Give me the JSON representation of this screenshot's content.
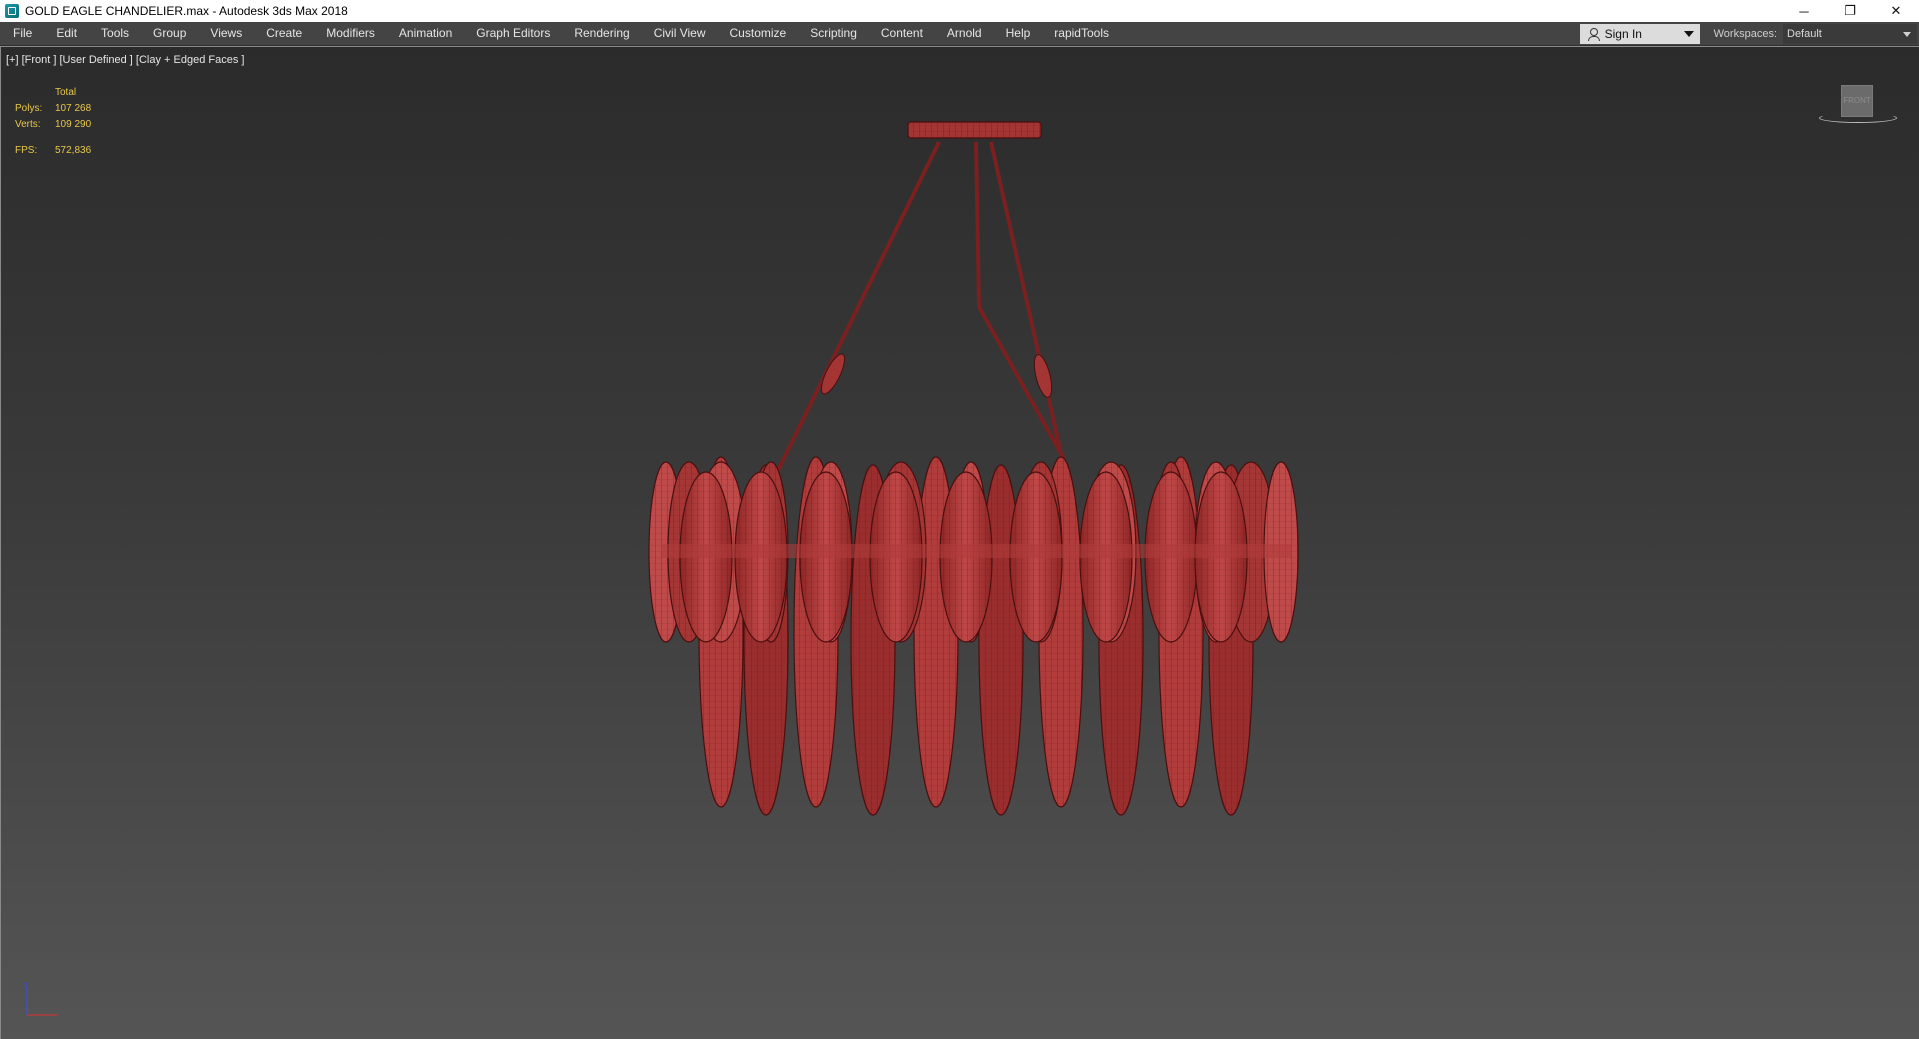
{
  "window": {
    "title": "GOLD EAGLE CHANDELIER.max - Autodesk 3ds Max 2018",
    "minimize_glyph": "─",
    "restore_glyph": "❐",
    "close_glyph": "✕"
  },
  "menubar": {
    "items": [
      "File",
      "Edit",
      "Tools",
      "Group",
      "Views",
      "Create",
      "Modifiers",
      "Animation",
      "Graph Editors",
      "Rendering",
      "Civil View",
      "Customize",
      "Scripting",
      "Content",
      "Arnold",
      "Help",
      "rapidTools"
    ],
    "signin_label": "Sign In",
    "workspaces_label": "Workspaces:",
    "workspace_value": "Default"
  },
  "viewport": {
    "label": "[+] [Front ] [User Defined ] [Clay + Edged Faces ]",
    "stats": {
      "header": "Total",
      "polys_label": "Polys:",
      "polys_value": "107 268",
      "verts_label": "Verts:",
      "verts_value": "109 290",
      "fps_label": "FPS:",
      "fps_value": "572,836"
    },
    "viewcube_label": "FRONT",
    "model_color": "#a83a3a",
    "model_edge_color": "#4a0f0f"
  },
  "icons": {
    "app": "3ds-max-icon",
    "user": "user-icon",
    "axis": "axis-tripod-icon"
  }
}
